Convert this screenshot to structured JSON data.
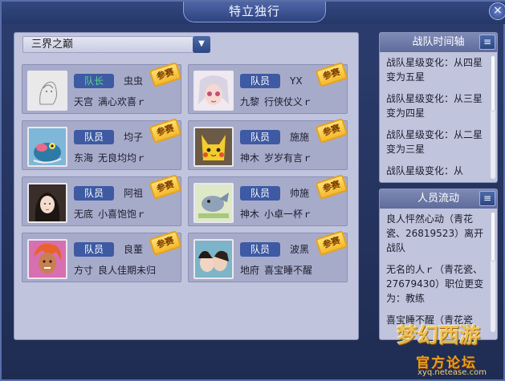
{
  "window": {
    "title": "特立独行",
    "close_label": "×"
  },
  "server": {
    "selected": "三界之巅",
    "arrow": "▼"
  },
  "members": [
    {
      "role": "队长",
      "name": "虫虫",
      "sect": "天宫",
      "tail": "满心欢喜ｒ",
      "stamp": "参赛",
      "avatar": "sketch"
    },
    {
      "role": "队员",
      "name": "YX",
      "sect": "九黎",
      "tail": "行侠仗义ｒ",
      "stamp": "参赛",
      "avatar": "anime"
    },
    {
      "role": "队员",
      "name": "均子",
      "sect": "东海",
      "tail": "无良均均ｒ",
      "stamp": "参赛",
      "avatar": "frog"
    },
    {
      "role": "队员",
      "name": "施施",
      "sect": "神木",
      "tail": "岁岁有言ｒ",
      "stamp": "参赛",
      "avatar": "pikachu"
    },
    {
      "role": "队员",
      "name": "阿祖",
      "sect": "无底",
      "tail": "小喜饱饱ｒ",
      "stamp": "参赛",
      "avatar": "girl"
    },
    {
      "role": "队员",
      "name": "帅施",
      "sect": "神木",
      "tail": "小卓一杯ｒ",
      "stamp": "参赛",
      "avatar": "cartoon"
    },
    {
      "role": "队员",
      "name": "良董",
      "sect": "方寸",
      "tail": "良人佳期未归",
      "stamp": "参赛",
      "avatar": "warrior"
    },
    {
      "role": "队员",
      "name": "波黑",
      "sect": "地府",
      "tail": "喜宝睡不醒",
      "stamp": "参赛",
      "avatar": "couple"
    }
  ],
  "timeline": {
    "title": "战队时间轴",
    "menu_icon": "≡",
    "entries": [
      "战队星级变化：从四星变为五星",
      "战队星级变化：从三星变为四星",
      "战队星级变化：从二星变为三星",
      "战队星级变化：从"
    ]
  },
  "flow": {
    "title": "人员流动",
    "menu_icon": "≡",
    "entries": [
      "良人怦然心动（青花瓷、26819523）离开战队",
      "无名的人ｒ（青花瓷、27679430）职位更变为：教练",
      "喜宝睡不醒（青花瓷"
    ]
  },
  "watermark": {
    "logo": "梦幻西游",
    "text": "官方论坛",
    "url": "xyq.netease.com"
  },
  "colors": {
    "captain_role": "#5dd28c",
    "stamp": "#f5b92c",
    "badge": "#3e5aa3"
  }
}
